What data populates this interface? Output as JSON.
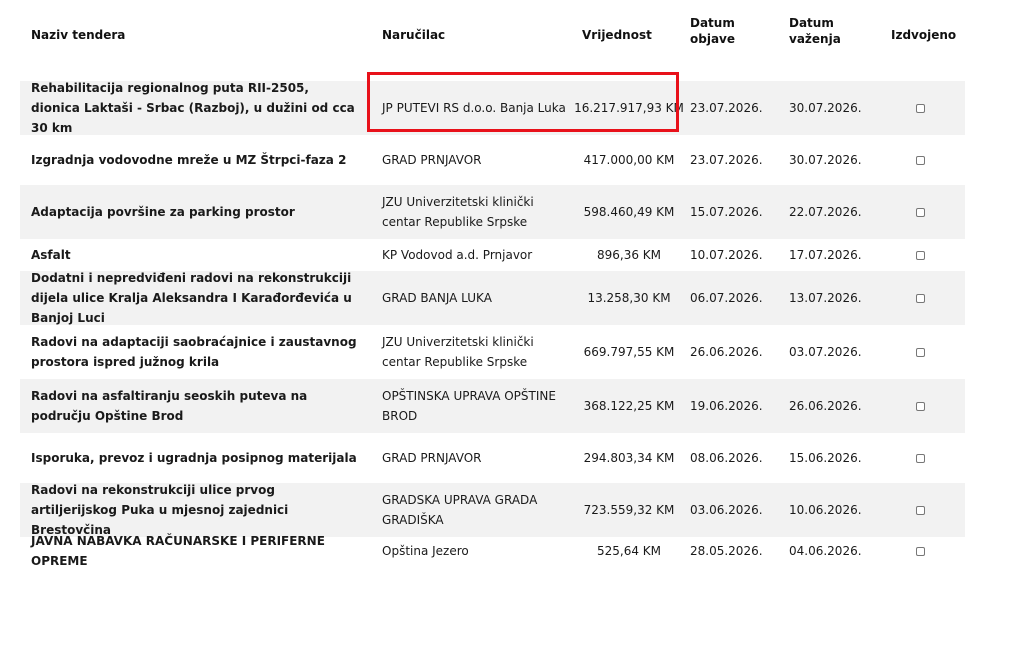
{
  "headers": {
    "name": "Naziv tendera",
    "buyer": "Naručilac",
    "value": "Vrijednost",
    "published_1": "Datum",
    "published_2": "objave",
    "expires_1": "Datum",
    "expires_2": "važenja",
    "featured": "Izdvojeno"
  },
  "rows": [
    {
      "name": "Rehabilitacija regionalnog puta RII-2505, dionica Laktaši - Srbac (Razboj), u dužini od cca 30 km",
      "buyer": "JP PUTEVI RS d.o.o. Banja Luka",
      "value": "16.217.917,93 KM",
      "published": "23.07.2026.",
      "expires": "30.07.2026.",
      "featured": false
    },
    {
      "name": "Izgradnja vodovodne mreže u MZ Štrpci-faza 2",
      "buyer": "GRAD PRNJAVOR",
      "value": "417.000,00 KM",
      "published": "23.07.2026.",
      "expires": "30.07.2026.",
      "featured": false
    },
    {
      "name": "Adaptacija površine za parking prostor",
      "buyer": "JZU Univerzitetski klinički centar Republike Srpske",
      "value": "598.460,49 KM",
      "published": "15.07.2026.",
      "expires": "22.07.2026.",
      "featured": false
    },
    {
      "name": "Asfalt",
      "buyer": "KP Vodovod a.d. Prnjavor",
      "value": "896,36 KM",
      "published": "10.07.2026.",
      "expires": "17.07.2026.",
      "featured": false
    },
    {
      "name": "Dodatni i nepredviđeni radovi na rekonstrukciji dijela ulice Kralja Aleksandra I Karađorđevića u Banjoj Luci",
      "buyer": "GRAD BANJA LUKA",
      "value": "13.258,30 KM",
      "published": "06.07.2026.",
      "expires": "13.07.2026.",
      "featured": false
    },
    {
      "name": "Radovi na adaptaciji saobraćajnice i zaustavnog prostora ispred južnog krila",
      "buyer": "JZU Univerzitetski klinički centar Republike Srpske",
      "value": "669.797,55 KM",
      "published": "26.06.2026.",
      "expires": "03.07.2026.",
      "featured": false
    },
    {
      "name": "Radovi na asfaltiranju seoskih puteva na području Opštine Brod",
      "buyer": "OPŠTINSKA UPRAVA OPŠTINE BROD",
      "value": "368.122,25 KM",
      "published": "19.06.2026.",
      "expires": "26.06.2026.",
      "featured": false
    },
    {
      "name": "Isporuka, prevoz i ugradnja posipnog materijala",
      "buyer": "GRAD PRNJAVOR",
      "value": "294.803,34 KM",
      "published": "08.06.2026.",
      "expires": "15.06.2026.",
      "featured": false
    },
    {
      "name": "Radovi na rekonstrukciji ulice prvog artiljerijskog Puka u mjesnoj zajednici Brestovčina",
      "buyer": "GRADSKA UPRAVA GRADA GRADIŠKA",
      "value": "723.559,32 KM",
      "published": "03.06.2026.",
      "expires": "10.06.2026.",
      "featured": false
    },
    {
      "name": "JAVNA NABAVKA RAČUNARSKE I PERIFERNE OPREME",
      "buyer": "Opština Jezero",
      "value": "525,64 KM",
      "published": "28.05.2026.",
      "expires": "04.06.2026.",
      "featured": false
    }
  ]
}
